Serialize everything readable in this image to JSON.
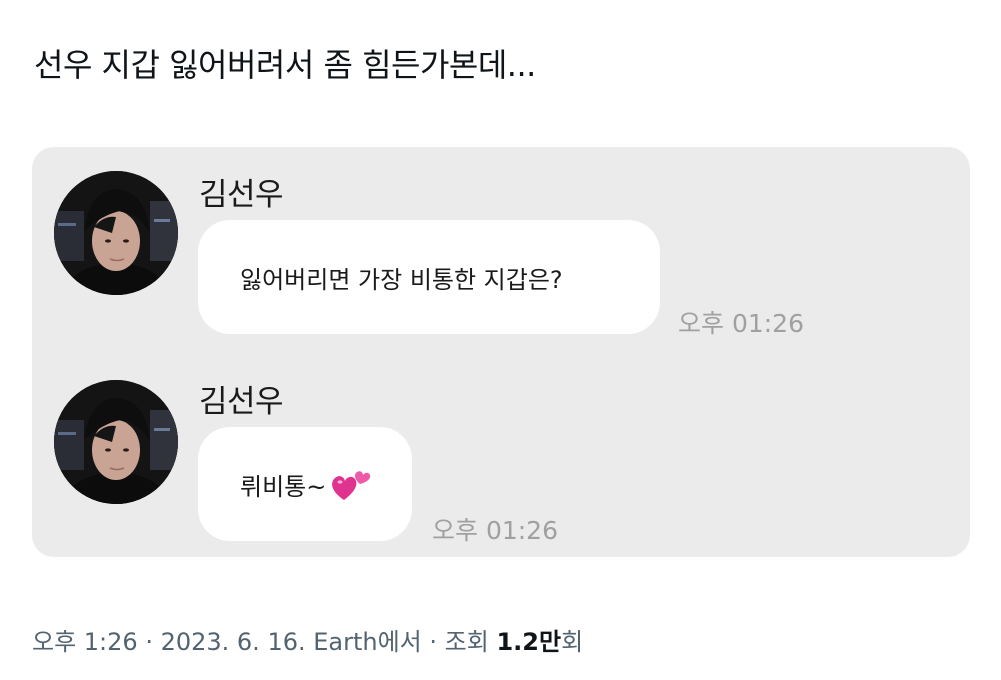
{
  "post": {
    "text": "선우 지갑 잃어버려서 좀 힘든가본데..."
  },
  "messages": [
    {
      "sender": "김선우",
      "avatar_icon": "profile-photo",
      "text": "잃어버리면 가장 비통한 지갑은?",
      "time": "오후 01:26"
    },
    {
      "sender": "김선우",
      "avatar_icon": "profile-photo",
      "text": "뤼비통~",
      "emoji": "two-hearts-emoji",
      "time": "오후 01:26"
    }
  ],
  "meta": {
    "time": "오후 1:26",
    "sep1": " · ",
    "date": "2023. 6. 16.",
    "source": " Earth에서",
    "sep2": " · ",
    "views_label": "조회 ",
    "views_count": "1.2만",
    "views_suffix": "회"
  },
  "colors": {
    "card_bg": "#ebebeb",
    "bubble_bg": "#ffffff",
    "timestamp": "#a0a0a0",
    "meta_text": "#536471",
    "heart": "#e0338f"
  }
}
